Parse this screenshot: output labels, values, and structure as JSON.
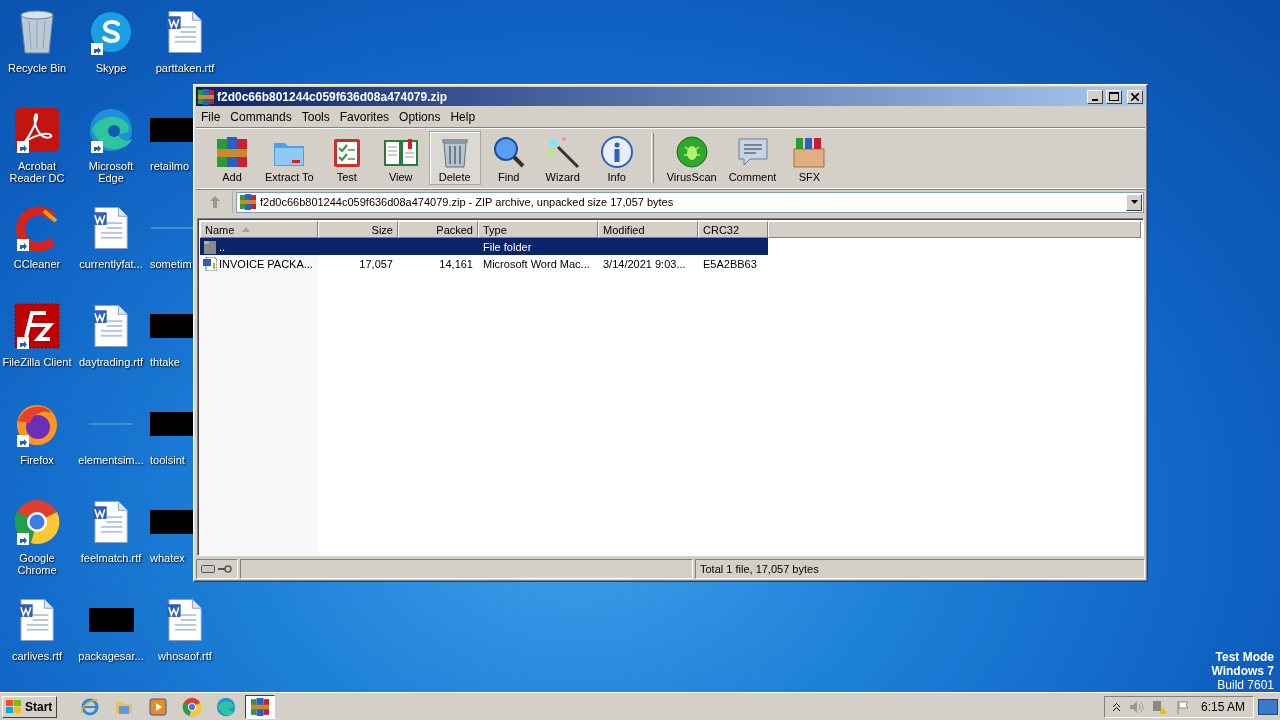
{
  "desktop_icons": [
    {
      "label": "Recycle Bin",
      "kind": "recycle",
      "shortcut": false,
      "partly_hidden": false
    },
    {
      "label": "Skype",
      "kind": "skype",
      "shortcut": true,
      "partly_hidden": false
    },
    {
      "label": "parttaken.rtf",
      "kind": "word",
      "shortcut": false,
      "partly_hidden": false
    },
    {
      "label": "Acrobat Reader DC",
      "kind": "acrobat",
      "shortcut": true,
      "partly_hidden": false
    },
    {
      "label": "Microsoft Edge",
      "kind": "edge",
      "shortcut": true,
      "partly_hidden": false
    },
    {
      "label": "retailmo",
      "kind": "redacted",
      "shortcut": false,
      "partly_hidden": true
    },
    {
      "label": "CCleaner",
      "kind": "ccleaner",
      "shortcut": true,
      "partly_hidden": false
    },
    {
      "label": "currentlyfat...",
      "kind": "word",
      "shortcut": false,
      "partly_hidden": false
    },
    {
      "label": "sometim",
      "kind": "blank",
      "shortcut": false,
      "partly_hidden": true
    },
    {
      "label": "FileZilla Client",
      "kind": "filezilla",
      "shortcut": true,
      "partly_hidden": false
    },
    {
      "label": "daytrading.rtf",
      "kind": "word",
      "shortcut": false,
      "partly_hidden": false
    },
    {
      "label": "thtake",
      "kind": "redacted",
      "shortcut": false,
      "partly_hidden": true
    },
    {
      "label": "Firefox",
      "kind": "firefox",
      "shortcut": true,
      "partly_hidden": false
    },
    {
      "label": "elementsim...",
      "kind": "blank",
      "shortcut": false,
      "partly_hidden": false
    },
    {
      "label": "toolsint",
      "kind": "redacted",
      "shortcut": false,
      "partly_hidden": true
    },
    {
      "label": "Google Chrome",
      "kind": "chrome",
      "shortcut": true,
      "partly_hidden": false
    },
    {
      "label": "feelmatch.rtf",
      "kind": "word",
      "shortcut": false,
      "partly_hidden": false
    },
    {
      "label": "whatex",
      "kind": "redacted",
      "shortcut": false,
      "partly_hidden": true
    },
    {
      "label": "carlives.rtf",
      "kind": "word",
      "shortcut": false,
      "partly_hidden": false
    },
    {
      "label": "packagesar...",
      "kind": "redacted",
      "shortcut": false,
      "partly_hidden": false
    },
    {
      "label": "whosaof.rtf",
      "kind": "word",
      "shortcut": false,
      "partly_hidden": false
    }
  ],
  "window": {
    "title": "f2d0c66b801244c059f636d08a474079.zip",
    "menu": [
      "File",
      "Commands",
      "Tools",
      "Favorites",
      "Options",
      "Help"
    ],
    "toolbar_groups": [
      {
        "buttons": [
          {
            "label": "Add",
            "kind": "add",
            "selected": false
          },
          {
            "label": "Extract To",
            "kind": "extract",
            "selected": false
          },
          {
            "label": "Test",
            "kind": "test",
            "selected": false
          },
          {
            "label": "View",
            "kind": "view",
            "selected": false
          },
          {
            "label": "Delete",
            "kind": "delete",
            "selected": true
          },
          {
            "label": "Find",
            "kind": "find",
            "selected": false
          },
          {
            "label": "Wizard",
            "kind": "wizard",
            "selected": false
          },
          {
            "label": "Info",
            "kind": "info",
            "selected": false
          }
        ]
      },
      {
        "buttons": [
          {
            "label": "VirusScan",
            "kind": "virusscan",
            "selected": false
          },
          {
            "label": "Comment",
            "kind": "comment",
            "selected": false
          },
          {
            "label": "SFX",
            "kind": "sfx",
            "selected": false
          }
        ]
      }
    ],
    "address": {
      "value": "f2d0c66b801244c059f636d08a474079.zip - ZIP archive, unpacked size 17,057 bytes",
      "up_disabled": true
    },
    "columns": [
      {
        "label": "Name",
        "sorted": true,
        "numeric": false
      },
      {
        "label": "Size",
        "sorted": false,
        "numeric": true
      },
      {
        "label": "Packed",
        "sorted": false,
        "numeric": true
      },
      {
        "label": "Type",
        "sorted": false,
        "numeric": false
      },
      {
        "label": "Modified",
        "sorted": false,
        "numeric": false
      },
      {
        "label": "CRC32",
        "sorted": false,
        "numeric": false
      }
    ],
    "rows": [
      {
        "kind": "folder",
        "selected": true,
        "name": "..",
        "type": "File folder"
      },
      {
        "kind": "word",
        "selected": false,
        "name": "INVOICE PACKA...",
        "size": "17,057",
        "packed": "14,161",
        "type": "Microsoft Word Mac...",
        "modified": "3/14/2021 9:03...",
        "crc32": "E5A2BB63"
      }
    ],
    "status": "Total 1 file, 17,057 bytes"
  },
  "desktop_watermark": [
    "Test Mode",
    "Windows 7",
    "Build 7601"
  ],
  "taskbar": {
    "start": "Start",
    "apps": [
      {
        "kind": "ie",
        "selected": false
      },
      {
        "kind": "explorer",
        "selected": false
      },
      {
        "kind": "media",
        "selected": false
      },
      {
        "kind": "chrome",
        "selected": false
      },
      {
        "kind": "edge",
        "selected": false
      },
      {
        "kind": "winrar",
        "selected": true
      }
    ],
    "clock": "6:15 AM"
  }
}
